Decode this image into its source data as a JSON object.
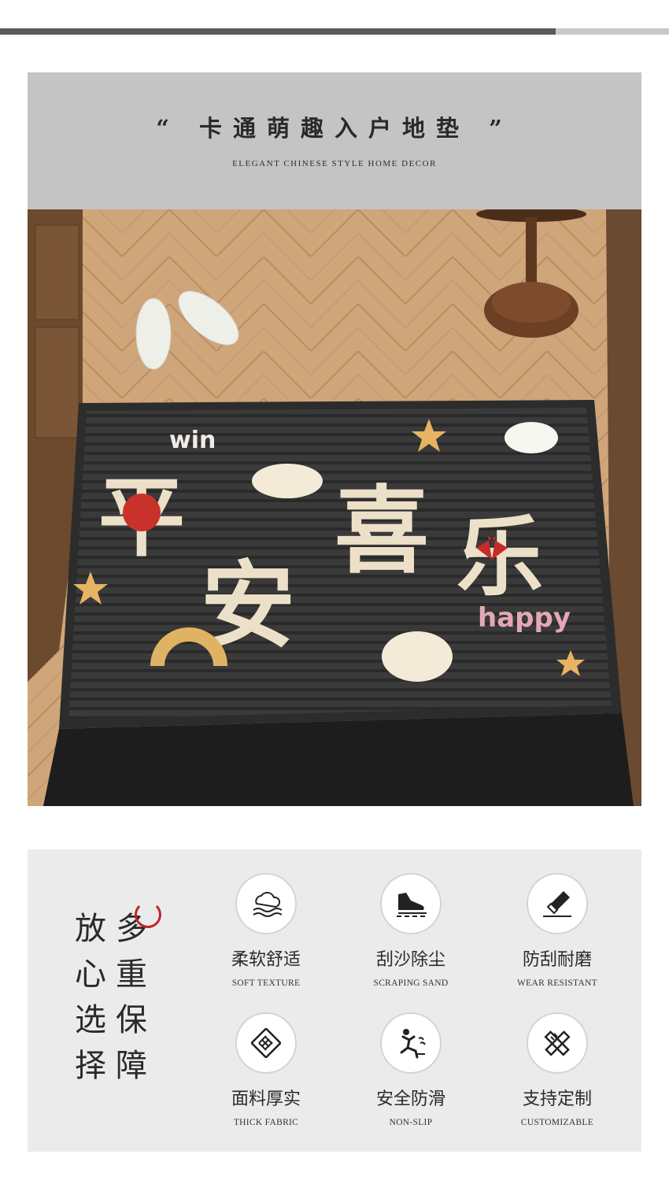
{
  "header": {
    "title": "“ 卡通萌趣入户地垫 ”",
    "subtitle": "ELEGANT CHINESE STYLE HOME DECOR"
  },
  "mat": {
    "main_text": [
      "平",
      "安",
      "喜",
      "乐"
    ],
    "win_label": "win",
    "happy_label": "happy"
  },
  "slogan": {
    "col1": [
      "放",
      "心",
      "选",
      "择"
    ],
    "col2": [
      "多",
      "重",
      "保",
      "障"
    ]
  },
  "features": [
    {
      "icon": "cloud-soft-icon",
      "cn": "柔软舒适",
      "en": "SOFT TEXTURE"
    },
    {
      "icon": "shoe-icon",
      "cn": "刮沙除尘",
      "en": "SCRAPING SAND"
    },
    {
      "icon": "knife-icon",
      "cn": "防刮耐磨",
      "en": "WEAR RESISTANT"
    },
    {
      "icon": "fabric-icon",
      "cn": "面料厚实",
      "en": "THICK FABRIC"
    },
    {
      "icon": "slip-person-icon",
      "cn": "安全防滑",
      "en": "NON-SLIP"
    },
    {
      "icon": "tools-icon",
      "cn": "支持定制",
      "en": "CUSTOMIZABLE"
    }
  ],
  "colors": {
    "header_bg": "#c4c4c4",
    "features_bg": "#ebebeb",
    "accent_red": "#c0252a"
  }
}
